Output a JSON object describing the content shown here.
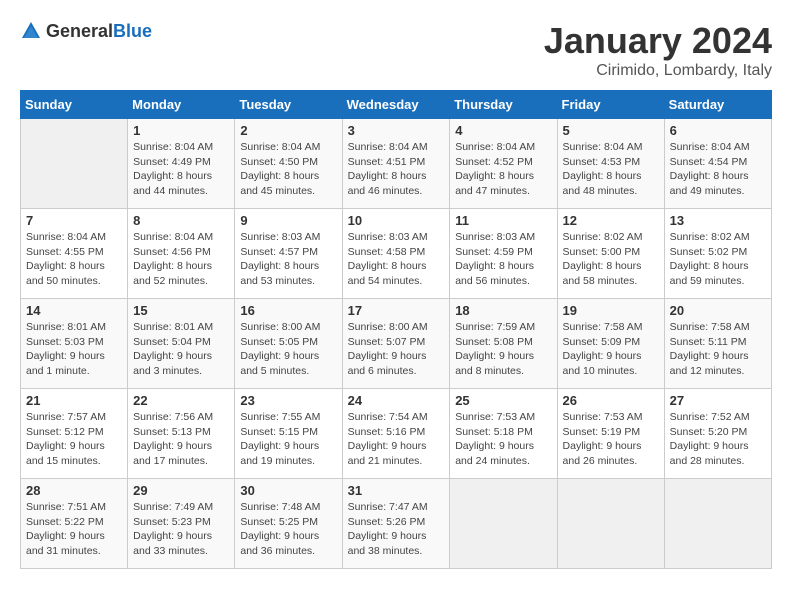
{
  "logo": {
    "text_general": "General",
    "text_blue": "Blue"
  },
  "header": {
    "month": "January 2024",
    "location": "Cirimido, Lombardy, Italy"
  },
  "weekdays": [
    "Sunday",
    "Monday",
    "Tuesday",
    "Wednesday",
    "Thursday",
    "Friday",
    "Saturday"
  ],
  "weeks": [
    [
      {
        "day": "",
        "sunrise": "",
        "sunset": "",
        "daylight": ""
      },
      {
        "day": "1",
        "sunrise": "Sunrise: 8:04 AM",
        "sunset": "Sunset: 4:49 PM",
        "daylight": "Daylight: 8 hours and 44 minutes."
      },
      {
        "day": "2",
        "sunrise": "Sunrise: 8:04 AM",
        "sunset": "Sunset: 4:50 PM",
        "daylight": "Daylight: 8 hours and 45 minutes."
      },
      {
        "day": "3",
        "sunrise": "Sunrise: 8:04 AM",
        "sunset": "Sunset: 4:51 PM",
        "daylight": "Daylight: 8 hours and 46 minutes."
      },
      {
        "day": "4",
        "sunrise": "Sunrise: 8:04 AM",
        "sunset": "Sunset: 4:52 PM",
        "daylight": "Daylight: 8 hours and 47 minutes."
      },
      {
        "day": "5",
        "sunrise": "Sunrise: 8:04 AM",
        "sunset": "Sunset: 4:53 PM",
        "daylight": "Daylight: 8 hours and 48 minutes."
      },
      {
        "day": "6",
        "sunrise": "Sunrise: 8:04 AM",
        "sunset": "Sunset: 4:54 PM",
        "daylight": "Daylight: 8 hours and 49 minutes."
      }
    ],
    [
      {
        "day": "7",
        "sunrise": "Sunrise: 8:04 AM",
        "sunset": "Sunset: 4:55 PM",
        "daylight": "Daylight: 8 hours and 50 minutes."
      },
      {
        "day": "8",
        "sunrise": "Sunrise: 8:04 AM",
        "sunset": "Sunset: 4:56 PM",
        "daylight": "Daylight: 8 hours and 52 minutes."
      },
      {
        "day": "9",
        "sunrise": "Sunrise: 8:03 AM",
        "sunset": "Sunset: 4:57 PM",
        "daylight": "Daylight: 8 hours and 53 minutes."
      },
      {
        "day": "10",
        "sunrise": "Sunrise: 8:03 AM",
        "sunset": "Sunset: 4:58 PM",
        "daylight": "Daylight: 8 hours and 54 minutes."
      },
      {
        "day": "11",
        "sunrise": "Sunrise: 8:03 AM",
        "sunset": "Sunset: 4:59 PM",
        "daylight": "Daylight: 8 hours and 56 minutes."
      },
      {
        "day": "12",
        "sunrise": "Sunrise: 8:02 AM",
        "sunset": "Sunset: 5:00 PM",
        "daylight": "Daylight: 8 hours and 58 minutes."
      },
      {
        "day": "13",
        "sunrise": "Sunrise: 8:02 AM",
        "sunset": "Sunset: 5:02 PM",
        "daylight": "Daylight: 8 hours and 59 minutes."
      }
    ],
    [
      {
        "day": "14",
        "sunrise": "Sunrise: 8:01 AM",
        "sunset": "Sunset: 5:03 PM",
        "daylight": "Daylight: 9 hours and 1 minute."
      },
      {
        "day": "15",
        "sunrise": "Sunrise: 8:01 AM",
        "sunset": "Sunset: 5:04 PM",
        "daylight": "Daylight: 9 hours and 3 minutes."
      },
      {
        "day": "16",
        "sunrise": "Sunrise: 8:00 AM",
        "sunset": "Sunset: 5:05 PM",
        "daylight": "Daylight: 9 hours and 5 minutes."
      },
      {
        "day": "17",
        "sunrise": "Sunrise: 8:00 AM",
        "sunset": "Sunset: 5:07 PM",
        "daylight": "Daylight: 9 hours and 6 minutes."
      },
      {
        "day": "18",
        "sunrise": "Sunrise: 7:59 AM",
        "sunset": "Sunset: 5:08 PM",
        "daylight": "Daylight: 9 hours and 8 minutes."
      },
      {
        "day": "19",
        "sunrise": "Sunrise: 7:58 AM",
        "sunset": "Sunset: 5:09 PM",
        "daylight": "Daylight: 9 hours and 10 minutes."
      },
      {
        "day": "20",
        "sunrise": "Sunrise: 7:58 AM",
        "sunset": "Sunset: 5:11 PM",
        "daylight": "Daylight: 9 hours and 12 minutes."
      }
    ],
    [
      {
        "day": "21",
        "sunrise": "Sunrise: 7:57 AM",
        "sunset": "Sunset: 5:12 PM",
        "daylight": "Daylight: 9 hours and 15 minutes."
      },
      {
        "day": "22",
        "sunrise": "Sunrise: 7:56 AM",
        "sunset": "Sunset: 5:13 PM",
        "daylight": "Daylight: 9 hours and 17 minutes."
      },
      {
        "day": "23",
        "sunrise": "Sunrise: 7:55 AM",
        "sunset": "Sunset: 5:15 PM",
        "daylight": "Daylight: 9 hours and 19 minutes."
      },
      {
        "day": "24",
        "sunrise": "Sunrise: 7:54 AM",
        "sunset": "Sunset: 5:16 PM",
        "daylight": "Daylight: 9 hours and 21 minutes."
      },
      {
        "day": "25",
        "sunrise": "Sunrise: 7:53 AM",
        "sunset": "Sunset: 5:18 PM",
        "daylight": "Daylight: 9 hours and 24 minutes."
      },
      {
        "day": "26",
        "sunrise": "Sunrise: 7:53 AM",
        "sunset": "Sunset: 5:19 PM",
        "daylight": "Daylight: 9 hours and 26 minutes."
      },
      {
        "day": "27",
        "sunrise": "Sunrise: 7:52 AM",
        "sunset": "Sunset: 5:20 PM",
        "daylight": "Daylight: 9 hours and 28 minutes."
      }
    ],
    [
      {
        "day": "28",
        "sunrise": "Sunrise: 7:51 AM",
        "sunset": "Sunset: 5:22 PM",
        "daylight": "Daylight: 9 hours and 31 minutes."
      },
      {
        "day": "29",
        "sunrise": "Sunrise: 7:49 AM",
        "sunset": "Sunset: 5:23 PM",
        "daylight": "Daylight: 9 hours and 33 minutes."
      },
      {
        "day": "30",
        "sunrise": "Sunrise: 7:48 AM",
        "sunset": "Sunset: 5:25 PM",
        "daylight": "Daylight: 9 hours and 36 minutes."
      },
      {
        "day": "31",
        "sunrise": "Sunrise: 7:47 AM",
        "sunset": "Sunset: 5:26 PM",
        "daylight": "Daylight: 9 hours and 38 minutes."
      },
      {
        "day": "",
        "sunrise": "",
        "sunset": "",
        "daylight": ""
      },
      {
        "day": "",
        "sunrise": "",
        "sunset": "",
        "daylight": ""
      },
      {
        "day": "",
        "sunrise": "",
        "sunset": "",
        "daylight": ""
      }
    ]
  ]
}
